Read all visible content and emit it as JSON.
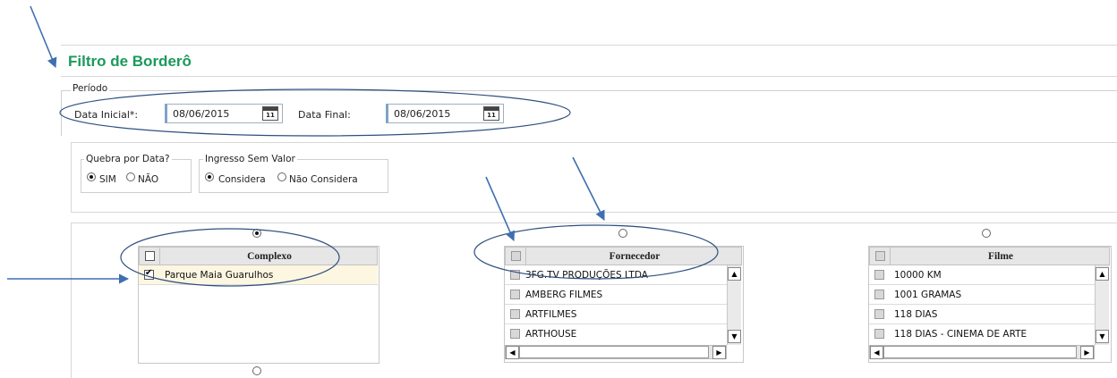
{
  "title": "Filtro de Borderô",
  "periodo": {
    "legend": "Período",
    "data_inicial_label": "Data Inicial*:",
    "data_inicial_value": "08/06/2015",
    "data_final_label": "Data Final:",
    "data_final_value": "08/06/2015",
    "calendar_icon_text": "11"
  },
  "quebra_por_data": {
    "legend": "Quebra por Data?",
    "options": [
      "SIM",
      "NÃO"
    ],
    "selected": "SIM"
  },
  "ingresso_sem_valor": {
    "legend": "Ingresso Sem Valor",
    "options": [
      "Considera",
      "Não Considera"
    ],
    "selected": "Considera"
  },
  "complexo_grid": {
    "header": "Complexo",
    "rows": [
      {
        "label": "Parque Maia Guarulhos",
        "checked": true
      }
    ]
  },
  "fornecedor_grid": {
    "header": "Fornecedor",
    "rows": [
      {
        "label": "3FG.TV PRODUÇÕES LTDA",
        "checked": false
      },
      {
        "label": "AMBERG FILMES",
        "checked": false
      },
      {
        "label": "ARTFILMES",
        "checked": false
      },
      {
        "label": "ARTHOUSE",
        "checked": false
      }
    ]
  },
  "filme_grid": {
    "header": "Filme",
    "rows": [
      {
        "label": "10000 KM",
        "checked": false
      },
      {
        "label": "1001 GRAMAS",
        "checked": false
      },
      {
        "label": "118 DIAS",
        "checked": false
      },
      {
        "label": "118 DIAS - CINEMA DE ARTE",
        "checked": false
      }
    ]
  },
  "colors": {
    "title": "#1a9a5a",
    "annotation": "#3e6fb0",
    "selected_row": "#fdf6e1"
  }
}
